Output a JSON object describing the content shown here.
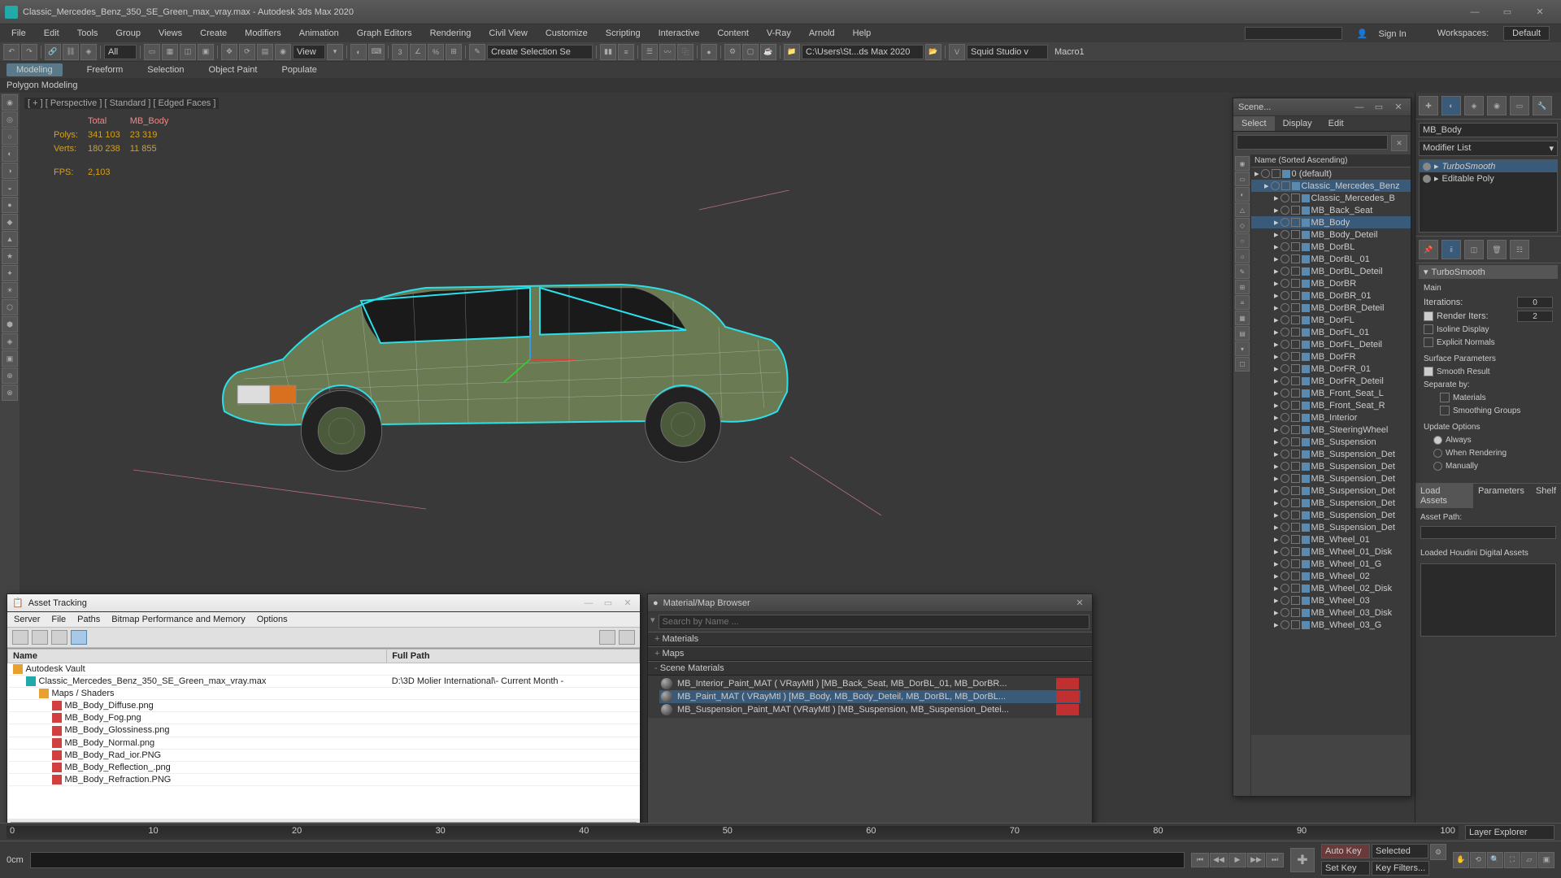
{
  "title": "Classic_Mercedes_Benz_350_SE_Green_max_vray.max - Autodesk 3ds Max 2020",
  "menus": [
    "File",
    "Edit",
    "Tools",
    "Group",
    "Views",
    "Create",
    "Modifiers",
    "Animation",
    "Graph Editors",
    "Rendering",
    "Civil View",
    "Customize",
    "Scripting",
    "Interactive",
    "Content",
    "V-Ray",
    "Arnold",
    "Help"
  ],
  "signin": "Sign In",
  "workspaces_lbl": "Workspaces:",
  "workspace": "Default",
  "toolbar": {
    "all": "All",
    "view": "View",
    "sel": "Create Selection Se",
    "path": "C:\\Users\\St...ds Max 2020",
    "studio": "Squid Studio v",
    "macro": "Macro1"
  },
  "ribbon": [
    "Modeling",
    "Freeform",
    "Selection",
    "Object Paint",
    "Populate"
  ],
  "ribbon_active": "Modeling",
  "ribbon_sub": "Polygon Modeling",
  "viewport": {
    "label": "[ + ] [ Perspective ] [ Standard ] [ Edged Faces ]",
    "hdr_total": "Total",
    "hdr_body": "MB_Body",
    "polys_lbl": "Polys:",
    "polys_total": "341 103",
    "polys_body": "23 319",
    "verts_lbl": "Verts:",
    "verts_total": "180 238",
    "verts_body": "11 855",
    "fps_lbl": "FPS:",
    "fps": "2,103"
  },
  "scene": {
    "title": "Scene...",
    "tabs": [
      "Select",
      "Display",
      "Edit"
    ],
    "col": "Name (Sorted Ascending)",
    "items": [
      {
        "n": "0 (default)",
        "d": 0,
        "t": "layer"
      },
      {
        "n": "Classic_Mercedes_Benz",
        "d": 1,
        "t": "layer",
        "sel": true
      },
      {
        "n": "Classic_Mercedes_B",
        "d": 2
      },
      {
        "n": "MB_Back_Seat",
        "d": 2
      },
      {
        "n": "MB_Body",
        "d": 2,
        "sel": true
      },
      {
        "n": "MB_Body_Deteil",
        "d": 2
      },
      {
        "n": "MB_DorBL",
        "d": 2
      },
      {
        "n": "MB_DorBL_01",
        "d": 2
      },
      {
        "n": "MB_DorBL_Deteil",
        "d": 2
      },
      {
        "n": "MB_DorBR",
        "d": 2
      },
      {
        "n": "MB_DorBR_01",
        "d": 2
      },
      {
        "n": "MB_DorBR_Deteil",
        "d": 2
      },
      {
        "n": "MB_DorFL",
        "d": 2
      },
      {
        "n": "MB_DorFL_01",
        "d": 2
      },
      {
        "n": "MB_DorFL_Deteil",
        "d": 2
      },
      {
        "n": "MB_DorFR",
        "d": 2
      },
      {
        "n": "MB_DorFR_01",
        "d": 2
      },
      {
        "n": "MB_DorFR_Deteil",
        "d": 2
      },
      {
        "n": "MB_Front_Seat_L",
        "d": 2
      },
      {
        "n": "MB_Front_Seat_R",
        "d": 2
      },
      {
        "n": "MB_Interior",
        "d": 2
      },
      {
        "n": "MB_SteeringWheel",
        "d": 2
      },
      {
        "n": "MB_Suspension",
        "d": 2
      },
      {
        "n": "MB_Suspension_Det",
        "d": 2
      },
      {
        "n": "MB_Suspension_Det",
        "d": 2
      },
      {
        "n": "MB_Suspension_Det",
        "d": 2
      },
      {
        "n": "MB_Suspension_Det",
        "d": 2
      },
      {
        "n": "MB_Suspension_Det",
        "d": 2
      },
      {
        "n": "MB_Suspension_Det",
        "d": 2
      },
      {
        "n": "MB_Suspension_Det",
        "d": 2
      },
      {
        "n": "MB_Wheel_01",
        "d": 2
      },
      {
        "n": "MB_Wheel_01_Disk",
        "d": 2
      },
      {
        "n": "MB_Wheel_01_G",
        "d": 2
      },
      {
        "n": "MB_Wheel_02",
        "d": 2
      },
      {
        "n": "MB_Wheel_02_Disk",
        "d": 2
      },
      {
        "n": "MB_Wheel_03",
        "d": 2
      },
      {
        "n": "MB_Wheel_03_Disk",
        "d": 2
      },
      {
        "n": "MB_Wheel_03_G",
        "d": 2
      }
    ]
  },
  "cmdpanel": {
    "objname": "MB_Body",
    "modlist": "Modifier List",
    "mods": [
      {
        "n": "TurboSmooth",
        "sel": true,
        "it": true
      },
      {
        "n": "Editable Poly"
      }
    ],
    "ts_title": "TurboSmooth",
    "main_lbl": "Main",
    "iter_lbl": "Iterations:",
    "iter": "0",
    "rend_lbl": "Render Iters:",
    "rend": "2",
    "iso": "Isoline Display",
    "expn": "Explicit Normals",
    "surf": "Surface Parameters",
    "smooth": "Smooth Result",
    "sep": "Separate by:",
    "mat": "Materials",
    "sg": "Smoothing Groups",
    "upd": "Update Options",
    "always": "Always",
    "whenr": "When Rendering",
    "man": "Manually",
    "la": "Load Assets",
    "par": "Parameters",
    "shelf": "Shelf",
    "apath": "Asset Path:",
    "lhda": "Loaded Houdini Digital Assets"
  },
  "asset": {
    "title": "Asset Tracking",
    "menus": [
      "Server",
      "File",
      "Paths",
      "Bitmap Performance and Memory",
      "Options"
    ],
    "cols": [
      "Name",
      "Full Path"
    ],
    "rows": [
      {
        "ico": "fld",
        "n": "Autodesk Vault",
        "p": "",
        "d": 0
      },
      {
        "ico": "max",
        "n": "Classic_Mercedes_Benz_350_SE_Green_max_vray.max",
        "p": "D:\\3D Molier International\\- Current Month -",
        "d": 1
      },
      {
        "ico": "fld",
        "n": "Maps / Shaders",
        "p": "",
        "d": 2
      },
      {
        "ico": "png",
        "n": "MB_Body_Diffuse.png",
        "p": "",
        "d": 3
      },
      {
        "ico": "png",
        "n": "MB_Body_Fog.png",
        "p": "",
        "d": 3
      },
      {
        "ico": "png",
        "n": "MB_Body_Glossiness.png",
        "p": "",
        "d": 3
      },
      {
        "ico": "png",
        "n": "MB_Body_Normal.png",
        "p": "",
        "d": 3
      },
      {
        "ico": "png",
        "n": "MB_Body_Rad_ior.PNG",
        "p": "",
        "d": 3
      },
      {
        "ico": "png",
        "n": "MB_Body_Reflection_.png",
        "p": "",
        "d": 3
      },
      {
        "ico": "png",
        "n": "MB_Body_Refraction.PNG",
        "p": "",
        "d": 3
      }
    ]
  },
  "mat": {
    "title": "Material/Map Browser",
    "search_ph": "Search by Name ...",
    "cat_m": "Materials",
    "cat_mp": "Maps",
    "cat_s": "Scene Materials",
    "items": [
      {
        "n": "MB_Interior_Paint_MAT ( VRayMtl ) [MB_Back_Seat, MB_DorBL_01, MB_DorBR...",
        "warn": true
      },
      {
        "n": "MB_Paint_MAT ( VRayMtl ) [MB_Body, MB_Body_Deteil, MB_DorBL, MB_DorBL...",
        "sel": true,
        "warn": true
      },
      {
        "n": "MB_Suspension_Paint_MAT (VRayMtl ) [MB_Suspension, MB_Suspension_Detei...",
        "warn": true
      }
    ]
  },
  "layer": "Layer Explorer",
  "anim": {
    "autokey": "Auto Key",
    "selected": "Selected",
    "setkey": "Set Key",
    "keyf": "Key Filters..."
  },
  "ruler": [
    "0",
    "10",
    "20",
    "30",
    "40",
    "50",
    "60",
    "70",
    "80",
    "90",
    "100"
  ],
  "statusunit": "0cm"
}
